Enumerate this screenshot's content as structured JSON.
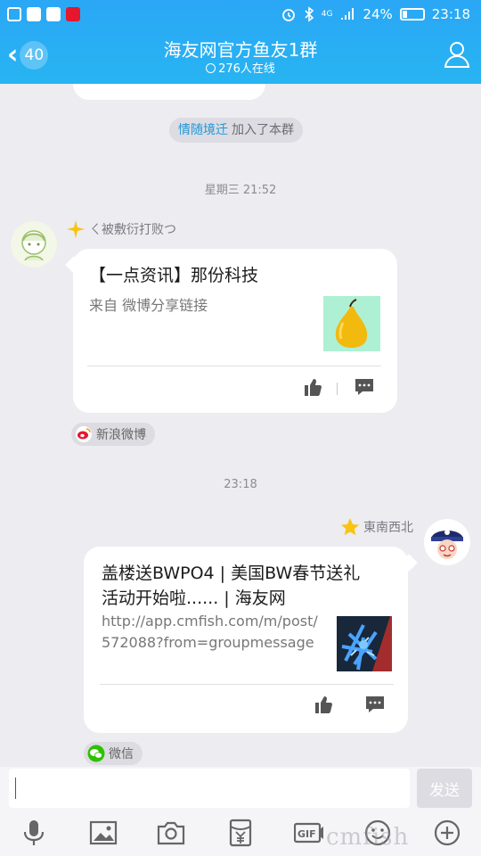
{
  "status_bar": {
    "battery": "24%",
    "time": "23:18",
    "signal_label": "4G",
    "battery_level": 0.24
  },
  "header": {
    "back_count": "40",
    "title": "海友网官方鱼友1群",
    "online": "276人在线"
  },
  "chat": {
    "system": {
      "name": "情随境迁",
      "text": "加入了本群"
    },
    "time1": "星期三 21:52",
    "msg1": {
      "nick": "ㄑ被敷衍打败つ",
      "title": "【一点资讯】那份科技",
      "desc": "来自 微博分享链接",
      "source": "新浪微博",
      "thumb_icon": "pear-icon"
    },
    "time2": "23:18",
    "msg2": {
      "nick": "東南西北",
      "title_line1": "盖楼送BWPO4 | 美国BW春节送礼",
      "title_line2": "活动开始啦...... | 海友网",
      "url_line1": "http://app.cmfish.com/m/post/",
      "url_line2": "572088?from=groupmessage",
      "source": "微信",
      "thumb_icon": "coral-icon"
    }
  },
  "input": {
    "send_label": "发送"
  },
  "watermark": "cmfish",
  "colors": {
    "header": "#2aa7f5",
    "system_name": "#2196d8",
    "wechat_green": "#2dc100",
    "weibo_red": "#e6162d"
  }
}
